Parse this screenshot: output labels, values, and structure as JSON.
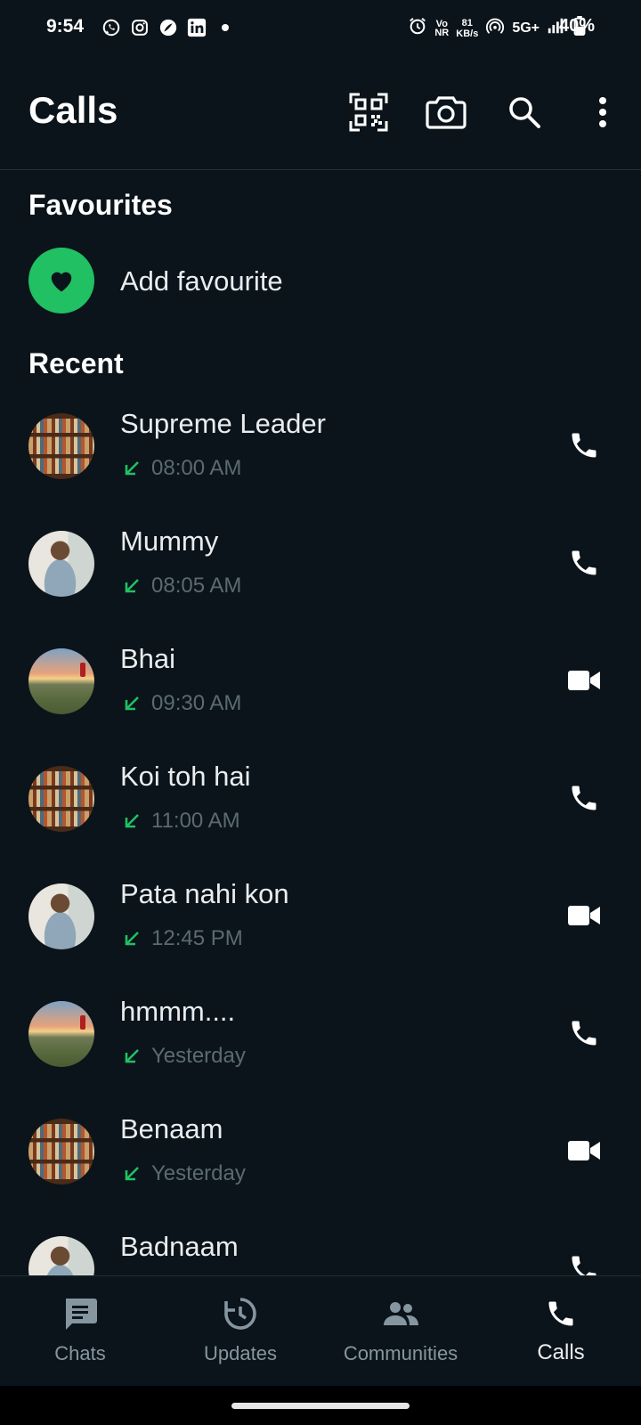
{
  "status": {
    "time": "9:54",
    "speed_value": "81",
    "speed_unit": "KB/s",
    "volte": "Vo\nNR",
    "network": "5G+",
    "battery": "40%"
  },
  "header": {
    "title": "Calls"
  },
  "favourites": {
    "heading": "Favourites",
    "add_label": "Add favourite"
  },
  "recent": {
    "heading": "Recent",
    "calls": [
      {
        "name": "Supreme Leader",
        "time": "08:00 AM",
        "type": "voice",
        "avatar": "books"
      },
      {
        "name": "Mummy",
        "time": "08:05 AM",
        "type": "voice",
        "avatar": "woman"
      },
      {
        "name": "Bhai",
        "time": "09:30 AM",
        "type": "video",
        "avatar": "sunset"
      },
      {
        "name": "Koi toh hai",
        "time": "11:00 AM",
        "type": "voice",
        "avatar": "books"
      },
      {
        "name": "Pata nahi kon",
        "time": "12:45 PM",
        "type": "video",
        "avatar": "woman"
      },
      {
        "name": "hmmm....",
        "time": "Yesterday",
        "type": "voice",
        "avatar": "sunset"
      },
      {
        "name": "Benaam",
        "time": "Yesterday",
        "type": "video",
        "avatar": "books"
      },
      {
        "name": "Badnaam",
        "time": "",
        "type": "voice",
        "avatar": "woman"
      }
    ]
  },
  "nav": {
    "chats": "Chats",
    "updates": "Updates",
    "communities": "Communities",
    "calls": "Calls"
  },
  "colors": {
    "accent": "#21c063",
    "background": "#0b141a",
    "muted": "#8696a0"
  }
}
